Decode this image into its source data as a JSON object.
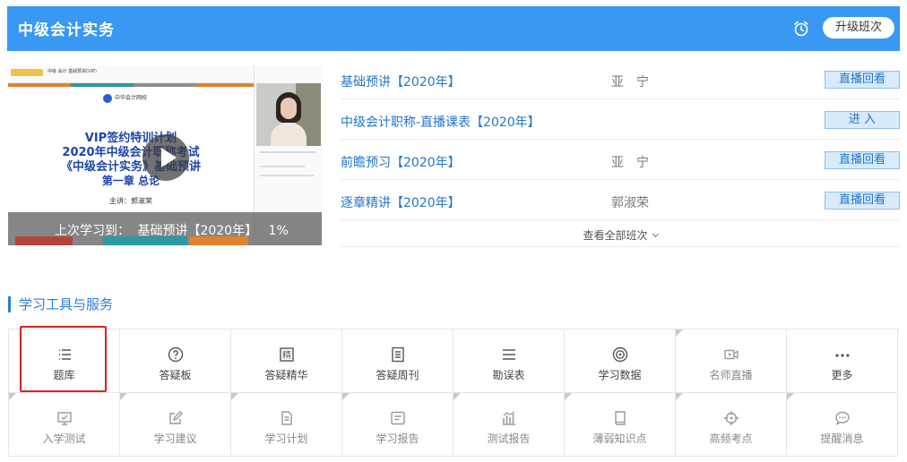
{
  "header": {
    "title": "中级会计实务",
    "upgrade_label": "升级班次",
    "alarm_icon": "alarm-clock-icon"
  },
  "video": {
    "topbar_text": "中级 会计 基础预讲(VIP)",
    "logo_text": "中华会计网校",
    "slide_lines": [
      "VIP签约特训计划",
      "2020年中级会计职称考试",
      "《中级会计实务》基础预讲",
      "第一章 总论"
    ],
    "lecturer": "主讲：郭淑荣",
    "last_study_prefix": "上次学习到：",
    "last_study_course": "基础预讲【2020年】",
    "last_study_progress": "1%",
    "colors": {
      "stripe_red": "#b4443a",
      "stripe_teal": "#2b9aa1",
      "stripe_orange": "#e0822e",
      "stripe_gray": "#8f8f8f"
    }
  },
  "classes": [
    {
      "name": "基础预讲【2020年】",
      "teacher": "亚　宁",
      "action": "直播回看"
    },
    {
      "name": "中级会计职称-直播课表【2020年】",
      "teacher": "",
      "action": "进 入"
    },
    {
      "name": "前瞻预习【2020年】",
      "teacher": "亚　宁",
      "action": "直播回看"
    },
    {
      "name": "逐章精讲【2020年】",
      "teacher": "郭淑荣",
      "action": "直播回看"
    }
  ],
  "view_all_label": "查看全部班次",
  "tools_section": {
    "title": "学习工具与服务",
    "row1": [
      {
        "label": "题库",
        "icon": "list-icon",
        "enabled": true
      },
      {
        "label": "答疑板",
        "icon": "question-circle-icon",
        "enabled": true
      },
      {
        "label": "答疑精华",
        "icon": "essence-char-icon",
        "enabled": true
      },
      {
        "label": "答疑周刊",
        "icon": "document-icon",
        "enabled": true
      },
      {
        "label": "勘误表",
        "icon": "menu-lines-icon",
        "enabled": true
      },
      {
        "label": "学习数据",
        "icon": "target-icon",
        "enabled": true
      },
      {
        "label": "名师直播",
        "icon": "video-camera-icon",
        "enabled": false
      },
      {
        "label": "更多",
        "icon": "more-dots-icon",
        "enabled": true
      }
    ],
    "row2": [
      {
        "label": "入学测试",
        "icon": "monitor-icon",
        "enabled": false
      },
      {
        "label": "学习建议",
        "icon": "edit-icon",
        "enabled": false
      },
      {
        "label": "学习计划",
        "icon": "file-icon",
        "enabled": false
      },
      {
        "label": "学习报告",
        "icon": "report-icon",
        "enabled": false
      },
      {
        "label": "测试报告",
        "icon": "bar-chart-icon",
        "enabled": false
      },
      {
        "label": "薄弱知识点",
        "icon": "book-icon",
        "enabled": false
      },
      {
        "label": "高频考点",
        "icon": "crosshair-icon",
        "enabled": false
      },
      {
        "label": "提醒消息",
        "icon": "message-bubble-icon",
        "enabled": false
      }
    ]
  }
}
